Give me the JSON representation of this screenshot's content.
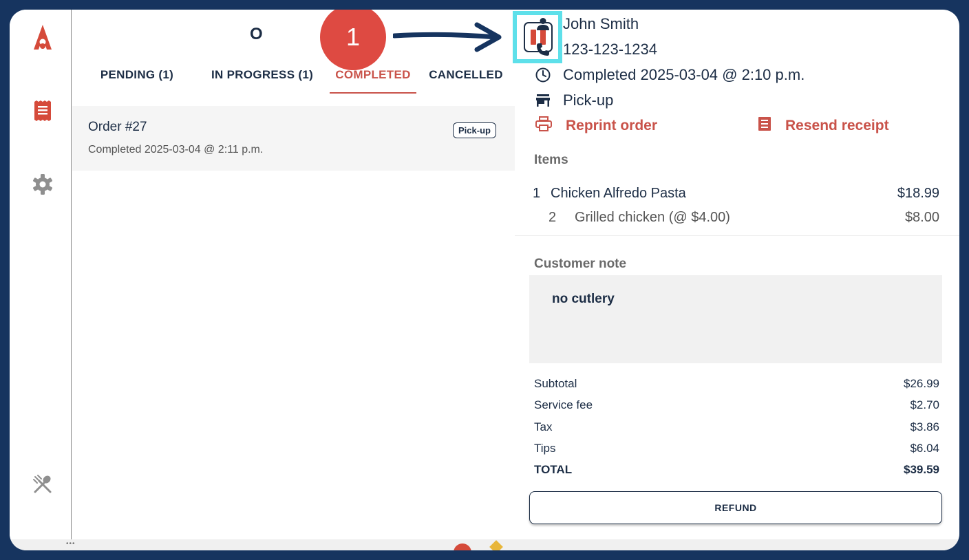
{
  "orders_panel": {
    "title": "O",
    "tabs": [
      {
        "label": "PENDING (1)"
      },
      {
        "label": "IN PROGRESS (1)"
      },
      {
        "label": "COMPLETED"
      },
      {
        "label": "CANCELLED"
      }
    ],
    "order": {
      "number": "Order #27",
      "time": "Completed 2025-03-04 @ 2:11 p.m.",
      "badge": "Pick-up"
    }
  },
  "callout": {
    "number": "1"
  },
  "customer": {
    "name": "John Smith",
    "phone": "123-123-1234",
    "status": "Completed 2025-03-04 @ 2:10 p.m.",
    "type": "Pick-up"
  },
  "actions": {
    "reprint": "Reprint order",
    "resend": "Resend receipt"
  },
  "items_section": {
    "label": "Items",
    "items": [
      {
        "qty": "1",
        "name": "Chicken Alfredo Pasta",
        "price": "$18.99"
      },
      {
        "qty": "2",
        "name": "Grilled chicken (@ $4.00)",
        "price": "$8.00"
      }
    ]
  },
  "note_section": {
    "label": "Customer note",
    "text": "no cutlery"
  },
  "totals": {
    "subtotal": {
      "label": "Subtotal",
      "value": "$26.99"
    },
    "service_fee": {
      "label": "Service fee",
      "value": "$2.70"
    },
    "tax": {
      "label": "Tax",
      "value": "$3.86"
    },
    "tips": {
      "label": "Tips",
      "value": "$6.04"
    },
    "total": {
      "label": "TOTAL",
      "value": "$39.59"
    }
  },
  "refund_label": "REFUND",
  "colors": {
    "accent_red": "#c9534a",
    "navy": "#1c2d45",
    "highlight": "#5ee0ea",
    "frame": "#16345f"
  }
}
